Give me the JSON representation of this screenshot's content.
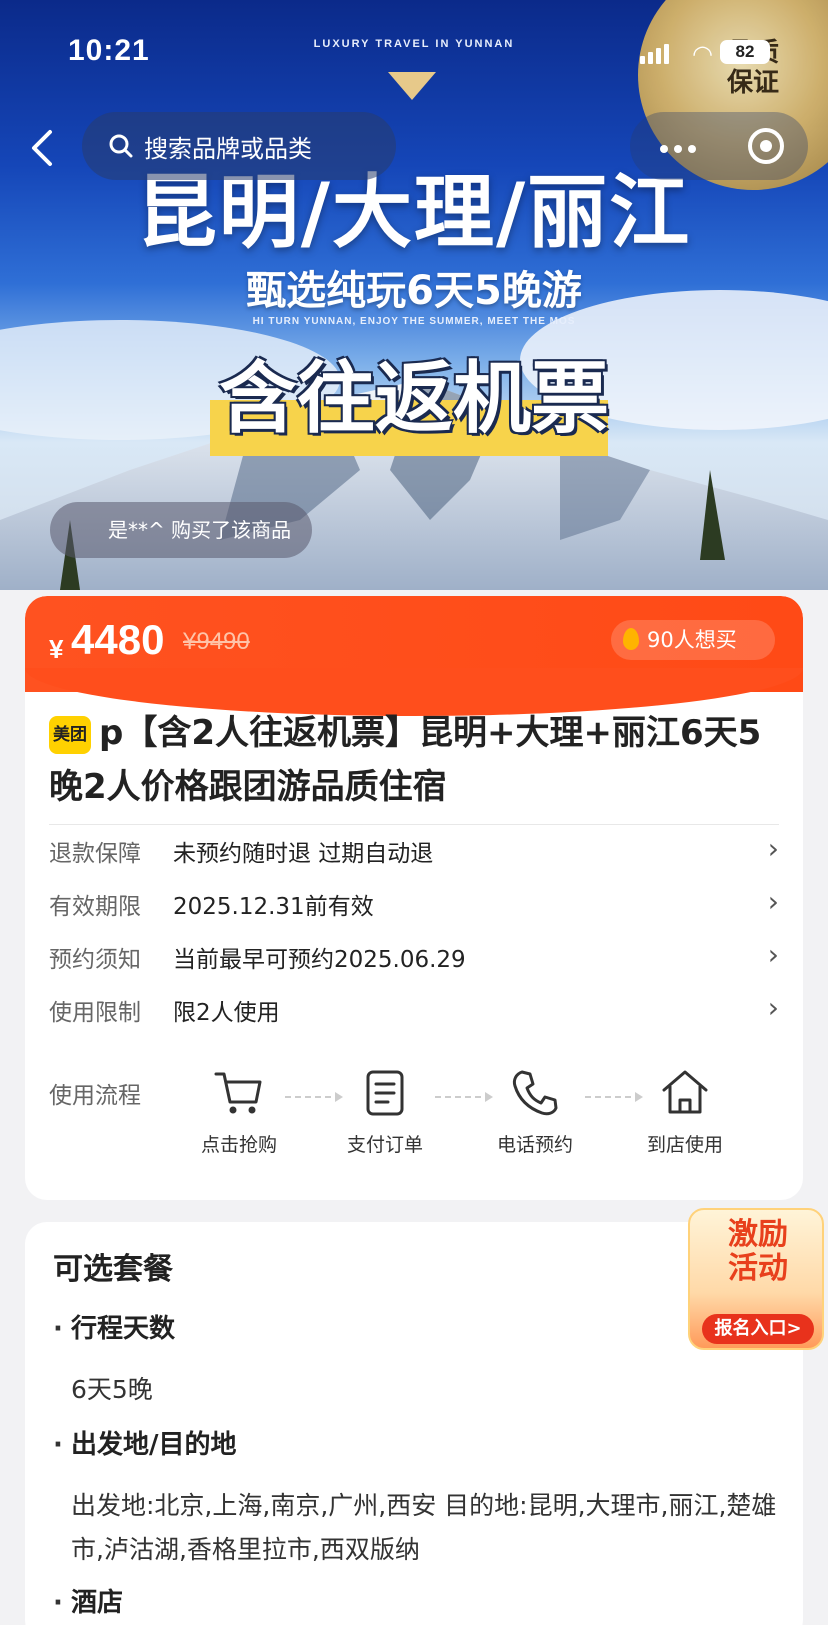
{
  "status": {
    "time": "10:21",
    "battery": "82"
  },
  "hero": {
    "top_tag": "LUXURY TRAVEL IN YUNNAN",
    "gold_badge": "品质\n保证",
    "headline": "昆明/大理/丽江",
    "subline": "甄选纯玩6天5晚游",
    "tiny_line": "HI TURN YUNNAN, ENJOY THE SUMMER, MEET THE MOS",
    "airline_text": "含往返机票",
    "buyer_notice": "是**^ 购买了该商品"
  },
  "search": {
    "placeholder": "搜索品牌或品类"
  },
  "price": {
    "currency": "¥",
    "current": "4480",
    "original": "¥9490",
    "want_count": "90人想买"
  },
  "product": {
    "badge": "美团",
    "title": "p【含2人往返机票】昆明+大理+丽江6天5晚2人价格跟团游品质住宿"
  },
  "info_rows": [
    {
      "label": "退款保障",
      "value": "未预约随时退 过期自动退"
    },
    {
      "label": "有效期限",
      "value": "2025.12.31前有效"
    },
    {
      "label": "预约须知",
      "value": "当前最早可预约2025.06.29"
    },
    {
      "label": "使用限制",
      "value": "限2人使用"
    }
  ],
  "flow": {
    "label": "使用流程",
    "steps": [
      {
        "label": "点击抢购",
        "icon": "cart-icon"
      },
      {
        "label": "支付订单",
        "icon": "document-icon"
      },
      {
        "label": "电话预约",
        "icon": "phone-icon"
      },
      {
        "label": "到店使用",
        "icon": "home-icon"
      }
    ]
  },
  "packages": {
    "title": "可选套餐",
    "sections": [
      {
        "heading": "行程天数",
        "text": "6天5晚"
      },
      {
        "heading": "出发地/目的地",
        "text": "出发地:北京,上海,南京,广州,西安 目的地:昆明,大理市,丽江,楚雄市,泸沽湖,香格里拉市,西双版纳"
      },
      {
        "heading": "酒店",
        "text": ""
      }
    ]
  },
  "promo": {
    "title_line1": "激励",
    "title_line2": "活动",
    "button": "报名入口>"
  }
}
